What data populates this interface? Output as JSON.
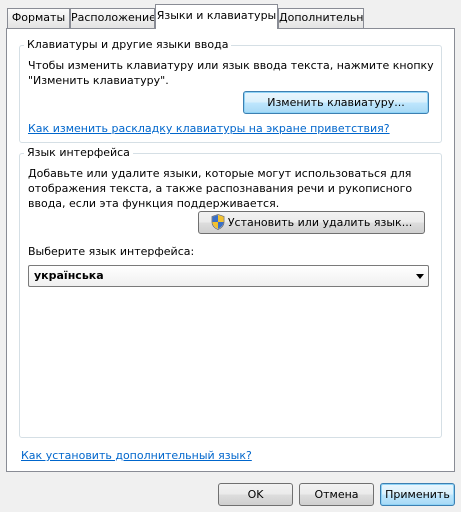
{
  "tabs": [
    {
      "label": "Форматы"
    },
    {
      "label": "Расположение"
    },
    {
      "label": "Языки и клавиатуры"
    },
    {
      "label": "Дополнительно"
    }
  ],
  "active_tab": "Языки и клавиатуры",
  "keyboards_group": {
    "title": "Клавиатуры и другие языки ввода",
    "description_line1": "Чтобы изменить клавиатуру или язык ввода текста, нажмите кнопку",
    "description_line2": "\"Изменить клавиатуру\".",
    "change_button_label": "Изменить клавиатуру...",
    "welcome_link": "Как изменить раскладку клавиатуры на экране приветствия?"
  },
  "interface_group": {
    "title": "Язык интерфейса",
    "description_line1": "Добавьте или удалите языки, которые могут использоваться для",
    "description_line2": "отображения текста, а также распознавания речи и рукописного",
    "description_line3": "ввода, если эта функция поддерживается.",
    "install_button_label": "Установить или удалить язык...",
    "select_label": "Выберите язык интерфейса:",
    "selected_language": "українська"
  },
  "additional_language_link": "Как установить дополнительный язык?",
  "footer": {
    "ok_label": "OK",
    "cancel_label": "Отмена",
    "apply_label": "Применить"
  },
  "icons": {
    "shield": "uac-shield-icon",
    "dropdown": "chevron-down-icon"
  },
  "colors": {
    "link": "#0066cc",
    "focus_border": "#3c7fb1"
  }
}
